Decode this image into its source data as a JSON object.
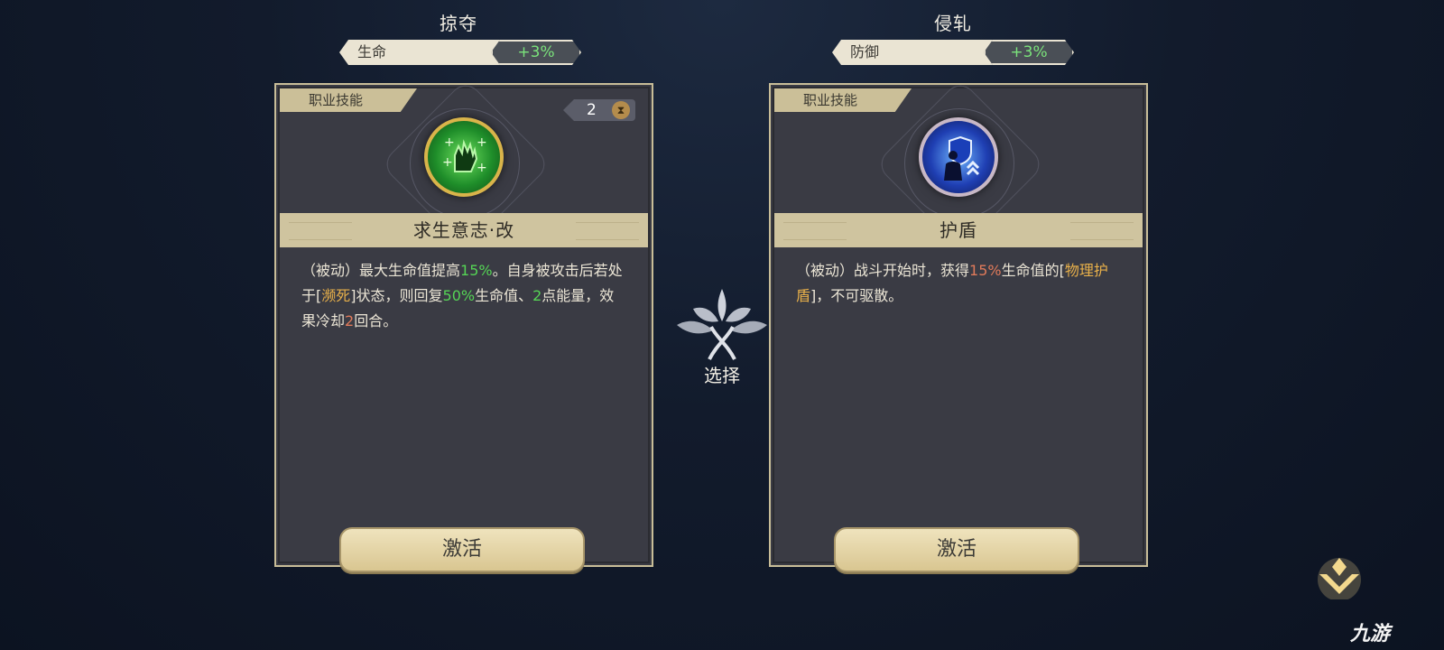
{
  "left": {
    "title": "掠夺",
    "stat_label": "生命",
    "stat_value": "+3%",
    "tab": "职业技能",
    "cooldown": "2",
    "skill_name": "求生意志·改",
    "desc": [
      {
        "t": "（被动）最大生命值提高",
        "c": ""
      },
      {
        "t": "15%",
        "c": "g"
      },
      {
        "t": "。自身被攻击后若处于[",
        "c": ""
      },
      {
        "t": "濒死",
        "c": "o"
      },
      {
        "t": "]状态，则回复",
        "c": ""
      },
      {
        "t": "50%",
        "c": "g"
      },
      {
        "t": "生命值、",
        "c": ""
      },
      {
        "t": "2",
        "c": "g"
      },
      {
        "t": "点能量，效果冷却",
        "c": ""
      },
      {
        "t": "2",
        "c": "r"
      },
      {
        "t": "回合。",
        "c": ""
      }
    ],
    "button": "激活",
    "icon": "gloved-hand-heal-icon"
  },
  "right": {
    "title": "侵轧",
    "stat_label": "防御",
    "stat_value": "+3%",
    "tab": "职业技能",
    "skill_name": "护盾",
    "desc": [
      {
        "t": "（被动）战斗开始时，获得",
        "c": ""
      },
      {
        "t": "15%",
        "c": "r"
      },
      {
        "t": "生命值的[",
        "c": ""
      },
      {
        "t": "物理护盾",
        "c": "o"
      },
      {
        "t": "]，不可驱散。",
        "c": ""
      }
    ],
    "button": "激活",
    "icon": "shield-figure-icon"
  },
  "center": {
    "label": "选择"
  },
  "watermark": "九游",
  "colors": {
    "green": "#55d455",
    "orange": "#e8b04a",
    "red": "#e07a5a",
    "gold": "#cfc49f"
  }
}
